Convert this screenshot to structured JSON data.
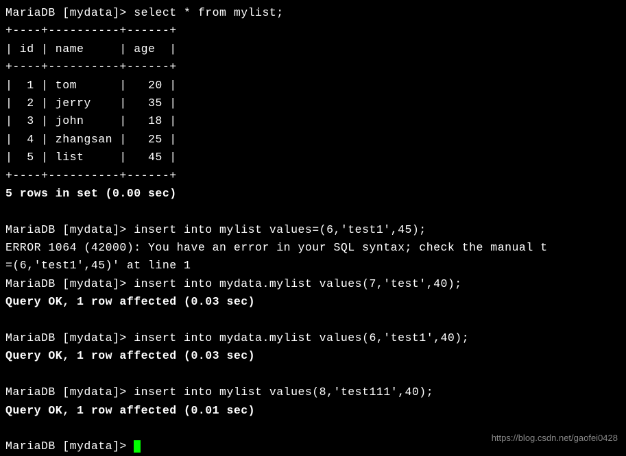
{
  "prompt": "MariaDB [mydata]> ",
  "query1": "select * from mylist;",
  "sep": "+----+----------+------+",
  "header": "| id | name     | age  |",
  "rows": [
    "|  1 | tom      |   20 |",
    "|  2 | jerry    |   35 |",
    "|  3 | john     |   18 |",
    "|  4 | zhangsan |   25 |",
    "|  5 | list     |   45 |"
  ],
  "result1": "5 rows in set (0.00 sec)",
  "query2": "insert into mylist values=(6,'test1',45);",
  "error1": "ERROR 1064 (42000): You have an error in your SQL syntax; check the manual t",
  "error2": "=(6,'test1',45)' at line 1",
  "query3": "insert into mydata.mylist values(7,'test',40);",
  "result3": "Query OK, 1 row affected (0.03 sec)",
  "query4": "insert into mydata.mylist values(6,'test1',40);",
  "result4": "Query OK, 1 row affected (0.03 sec)",
  "query5": "insert into mylist values(8,'test111',40);",
  "result5": "Query OK, 1 row affected (0.01 sec)",
  "watermark": "https://blog.csdn.net/gaofei0428"
}
